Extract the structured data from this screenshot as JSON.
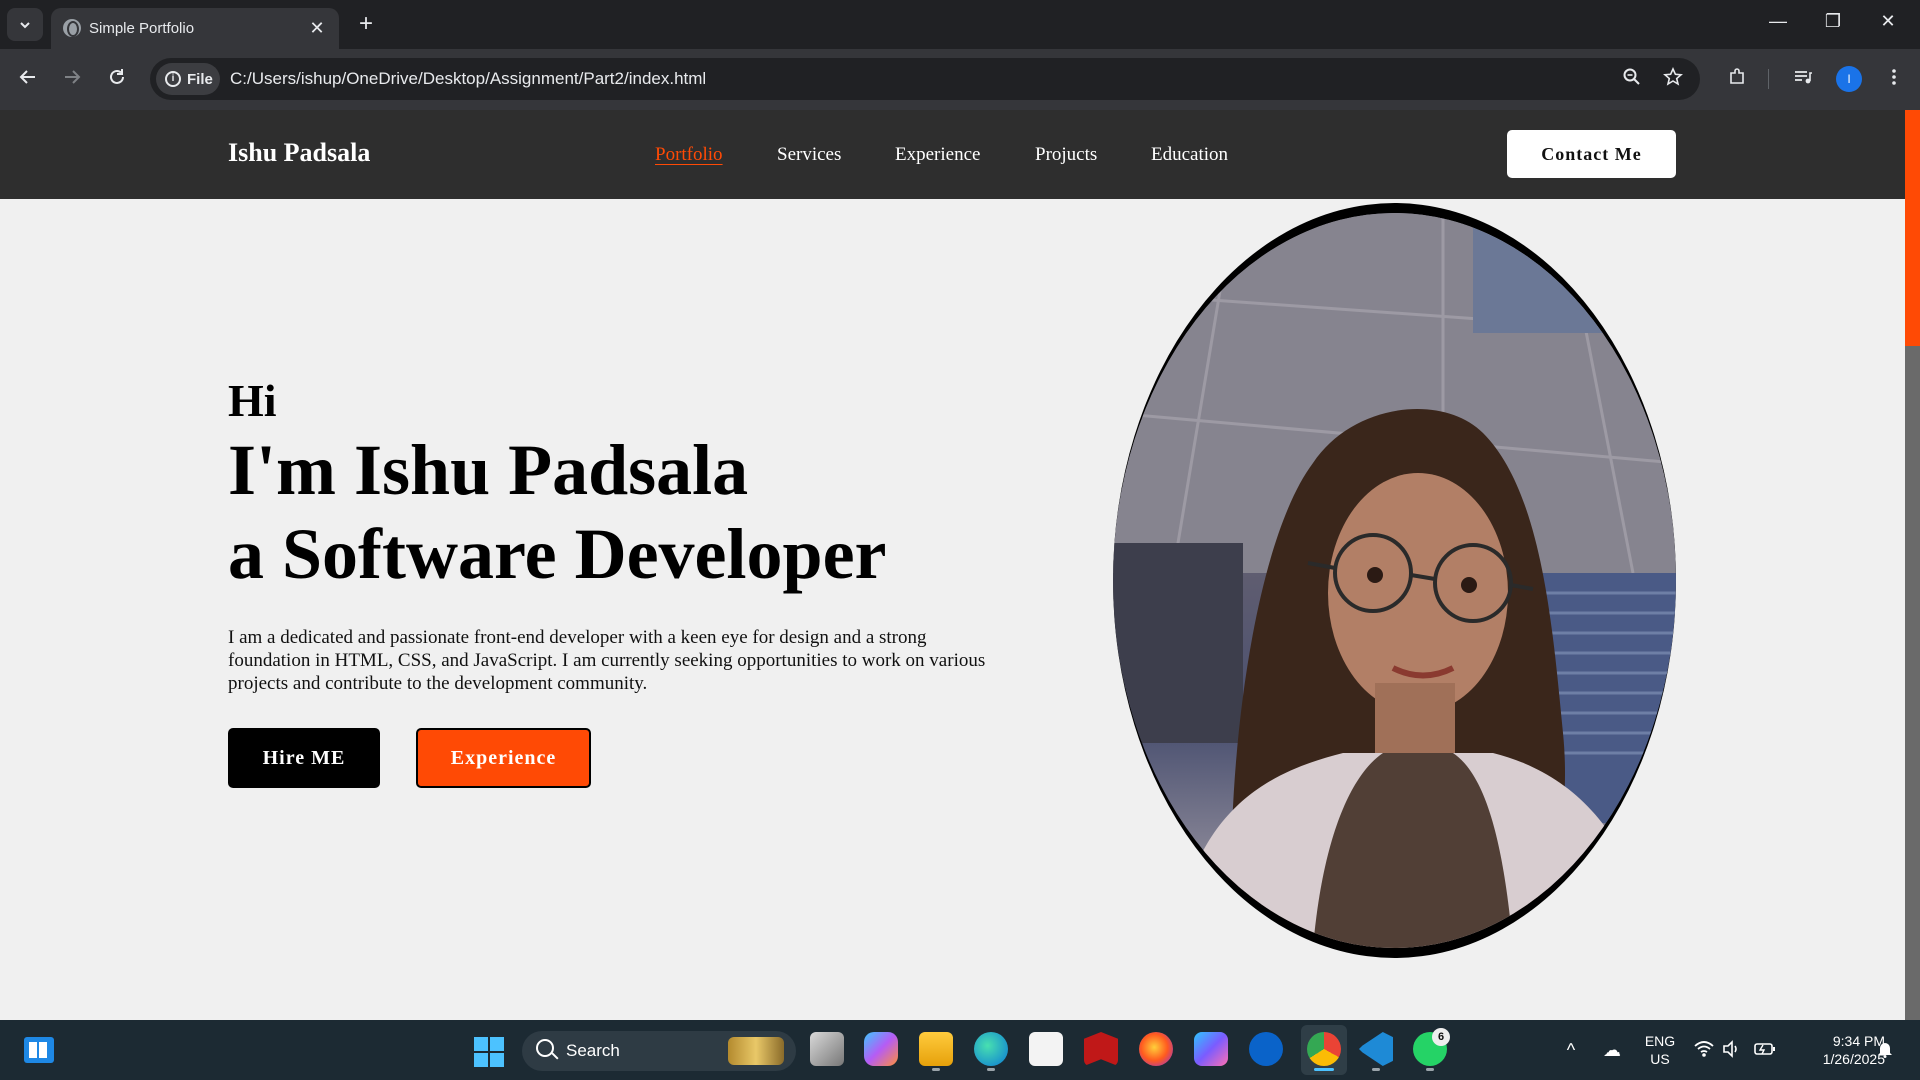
{
  "browser": {
    "tab_title": "Simple Portfolio",
    "tab_close": "✕",
    "new_tab": "+",
    "site_label": "File",
    "url": "C:/Users/ishup/OneDrive/Desktop/Assignment/Part2/index.html",
    "profile_initial": "I",
    "window": {
      "minimize": "—",
      "restore": "❐",
      "close": "✕"
    }
  },
  "page": {
    "brand": "Ishu Padsala",
    "nav": [
      {
        "label": "Portfolio",
        "active": true
      },
      {
        "label": "Services"
      },
      {
        "label": "Experience"
      },
      {
        "label": "Projucts"
      },
      {
        "label": "Education"
      }
    ],
    "contact_button": "Contact Me",
    "greeting": "Hi",
    "headline_1": "I'm Ishu Padsala",
    "headline_2": "a Software Developer",
    "bio": "I am a dedicated and passionate front-end developer with a keen eye for design and a strong foundation in HTML, CSS, and JavaScript. I am currently seeking opportunities to work on various projects and contribute to the development community.",
    "hire_button": "Hire ME",
    "experience_button": "Experience",
    "accent_color": "#ff4a05"
  },
  "taskbar": {
    "search_placeholder": "Search",
    "apps": [
      "task-view",
      "copilot",
      "file-explorer",
      "edge",
      "microsoft-store",
      "mcafee",
      "firefox",
      "m365",
      "dell",
      "chrome",
      "vscode",
      "whatsapp"
    ],
    "whatsapp_badge": "6",
    "lang_1": "ENG",
    "lang_2": "US",
    "time": "9:34 PM",
    "date": "1/26/2025"
  }
}
